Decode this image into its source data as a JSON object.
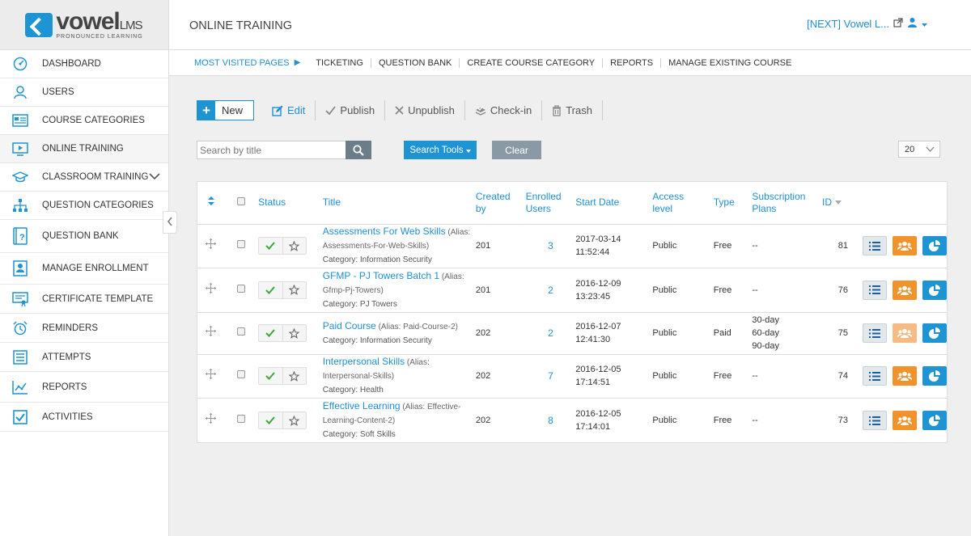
{
  "logo": {
    "main": "vowel",
    "suffix": "LMS",
    "sub": "PRONOUNCED LEARNING"
  },
  "page_title": "ONLINE TRAINING",
  "user_menu": {
    "label": "[NEXT] Vowel L..."
  },
  "sidebar": {
    "items": [
      {
        "label": "DASHBOARD",
        "icon": "dashboard-icon"
      },
      {
        "label": "USERS",
        "icon": "user-icon"
      },
      {
        "label": "COURSE CATEGORIES",
        "icon": "categories-icon"
      },
      {
        "label": "ONLINE TRAINING",
        "icon": "monitor-play-icon",
        "active": true
      },
      {
        "label": "CLASSROOM TRAINING",
        "icon": "graduation-cap-icon",
        "expandable": true
      },
      {
        "label": "QUESTION CATEGORIES",
        "icon": "hierarchy-icon"
      },
      {
        "label": "QUESTION BANK",
        "icon": "question-book-icon"
      },
      {
        "label": "MANAGE ENROLLMENT",
        "icon": "enrollment-icon"
      },
      {
        "label": "CERTIFICATE TEMPLATE",
        "icon": "certificate-icon"
      },
      {
        "label": "REMINDERS",
        "icon": "alarm-icon"
      },
      {
        "label": "ATTEMPTS",
        "icon": "list-icon"
      },
      {
        "label": "REPORTS",
        "icon": "line-chart-icon"
      },
      {
        "label": "ACTIVITIES",
        "icon": "checkbox-icon"
      }
    ]
  },
  "quicknav": {
    "first": "MOST VISITED PAGES",
    "items": [
      "TICKETING",
      "QUESTION BANK",
      "CREATE COURSE CATEGORY",
      "REPORTS",
      "MANAGE EXISTING COURSE"
    ]
  },
  "toolbar": {
    "new": "New",
    "edit": "Edit",
    "publish": "Publish",
    "unpublish": "Unpublish",
    "checkin": "Check-in",
    "trash": "Trash"
  },
  "search": {
    "placeholder": "Search by title",
    "tools": "Search Tools",
    "clear": "Clear"
  },
  "limit": {
    "value": "20"
  },
  "table": {
    "headers": {
      "status": "Status",
      "title": "Title",
      "created_1": "Created",
      "created_2": "by",
      "enrolled_1": "Enrolled",
      "enrolled_2": "Users",
      "start": "Start Date",
      "access_1": "Access",
      "access_2": "level",
      "type": "Type",
      "plans_1": "Subscription",
      "plans_2": "Plans",
      "id": "ID"
    },
    "rows": [
      {
        "title": "Assessments For Web Skills",
        "alias": " (Alias: Assessments-For-Web-Skills)",
        "category": "Category: Information Security",
        "created_by": "201",
        "enrolled": "3",
        "start_date": "2017-03-14",
        "start_time": "11:52:44",
        "access": "Public",
        "type": "Free",
        "plans": "--",
        "id": "81"
      },
      {
        "title": "GFMP - PJ Towers Batch 1",
        "alias": " (Alias: Gfmp-Pj-Towers)",
        "category": "Category: PJ Towers",
        "created_by": "201",
        "enrolled": "2",
        "start_date": "2016-12-09",
        "start_time": "13:23:45",
        "access": "Public",
        "type": "Free",
        "plans": "--",
        "id": "76"
      },
      {
        "title": "Paid Course",
        "alias": " (Alias: Paid-Course-2)",
        "category": "Category: Information Security",
        "created_by": "202",
        "enrolled": "2",
        "start_date": "2016-12-07",
        "start_time": "12:41:30",
        "access": "Public",
        "type": "Paid",
        "plans": "30-day",
        "plans_2": "60-day",
        "plans_3": "90-day",
        "id": "75"
      },
      {
        "title": "Interpersonal Skills",
        "alias": " (Alias: Interpersonal-Skills)",
        "category": "Category: Health",
        "created_by": "202",
        "enrolled": "7",
        "start_date": "2016-12-05",
        "start_time": "17:14:51",
        "access": "Public",
        "type": "Free",
        "plans": "--",
        "id": "74"
      },
      {
        "title": "Effective Learning",
        "alias": " (Alias: Effective-Learning-Content-2)",
        "category": "Category: Soft Skills",
        "created_by": "202",
        "enrolled": "8",
        "start_date": "2016-12-05",
        "start_time": "17:14:01",
        "access": "Public",
        "type": "Free",
        "plans": "--",
        "id": "73"
      }
    ]
  },
  "colors": {
    "accent": "#1f94d2",
    "orange": "#f2922b",
    "published": "#3aa83a"
  }
}
